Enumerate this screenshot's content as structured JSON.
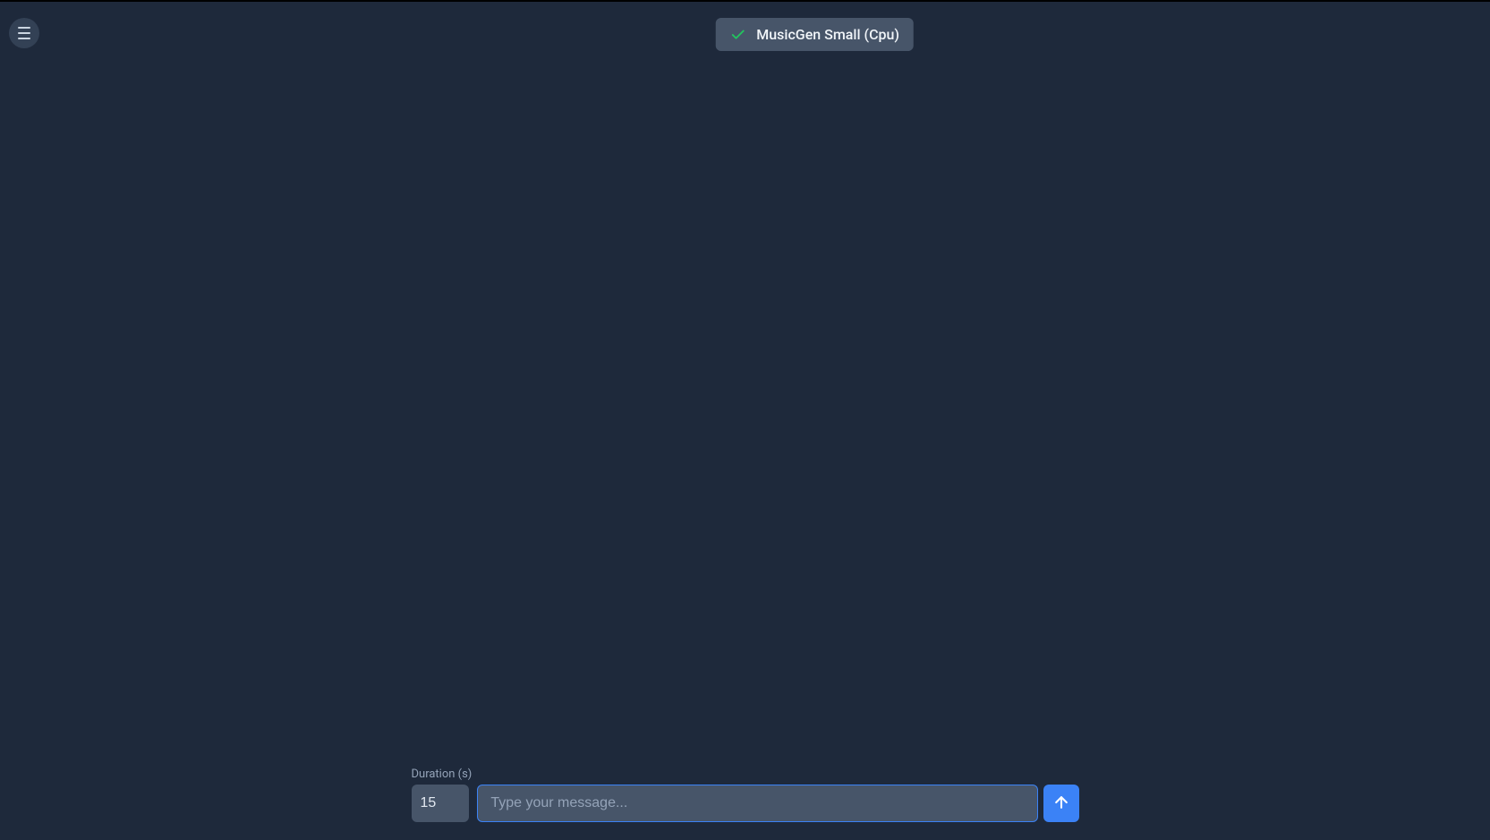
{
  "header": {
    "model_name": "MusicGen Small (Cpu)"
  },
  "input_bar": {
    "duration_label": "Duration (s)",
    "duration_value": "15",
    "message_placeholder": "Type your message...",
    "message_value": ""
  }
}
